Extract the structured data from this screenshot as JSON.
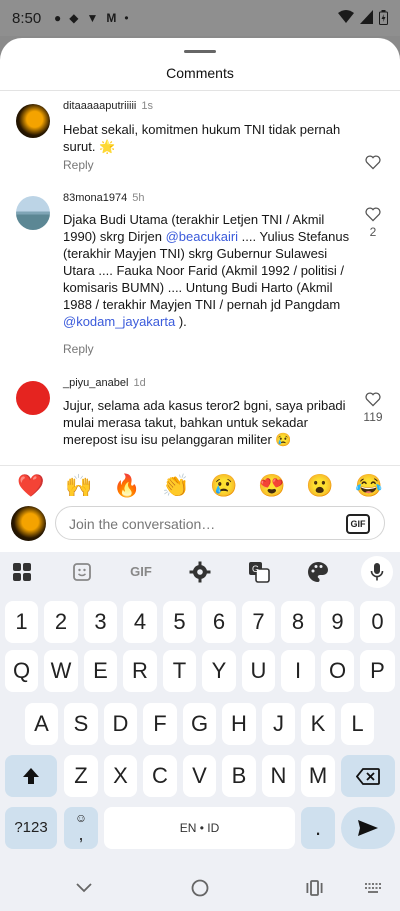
{
  "status_bar": {
    "time": "8:50"
  },
  "sheet": {
    "title": "Comments",
    "comments": [
      {
        "username": "ditaaaaaputriiiii",
        "ago": "1s",
        "text": "Hebat sekali, komitmen hukum TNI tidak pernah surut. 🌟",
        "reply_label": "Reply",
        "likes": ""
      },
      {
        "username": "83mona1974",
        "ago": "5h",
        "text_parts": [
          "Djaka Budi Utama (terakhir Letjen TNI / Akmil 1990) skrg Dirjen ",
          "@beacukairi",
          " .... Yulius Stefanus (terakhir Mayjen TNI) skrg Gubernur Sulawesi Utara .... Fauka Noor Farid (Akmil 1992 / politisi / komisaris BUMN) .... Untung Budi Harto (Akmil 1988 / terakhir Mayjen TNI / pernah jd Pangdam ",
          "@kodam_jayakarta",
          " )."
        ],
        "reply_label": "Reply",
        "likes": "2"
      },
      {
        "username": "_piyu_anabel",
        "ago": "1d",
        "text": "Jujur, selama ada kasus teror2 bgni, saya pribadi mulai merasa takut, bahkan untuk sekadar merepost isu isu pelanggaran militer 😢",
        "likes": "119"
      }
    ],
    "emoji_bar": [
      "❤️",
      "🙌",
      "🔥",
      "👏",
      "😢",
      "😍",
      "😮",
      "😂"
    ],
    "input": {
      "placeholder": "Join the conversation…",
      "gif_label": "GIF"
    }
  },
  "keyboard": {
    "toolbar_gif": "GIF",
    "row_numbers": [
      "1",
      "2",
      "3",
      "4",
      "5",
      "6",
      "7",
      "8",
      "9",
      "0"
    ],
    "row1": [
      "Q",
      "W",
      "E",
      "R",
      "T",
      "Y",
      "U",
      "I",
      "O",
      "P"
    ],
    "row2": [
      "A",
      "S",
      "D",
      "F",
      "G",
      "H",
      "J",
      "K",
      "L"
    ],
    "row3": [
      "Z",
      "X",
      "C",
      "V",
      "B",
      "N",
      "M"
    ],
    "symbols_label": "?123",
    "comma_label": ",",
    "space_label": "EN • ID",
    "period_label": "."
  },
  "colors": {
    "mention": "#3b5bdb",
    "keyboard_bg": "#eef0f5",
    "function_key": "#cfe0ee"
  }
}
